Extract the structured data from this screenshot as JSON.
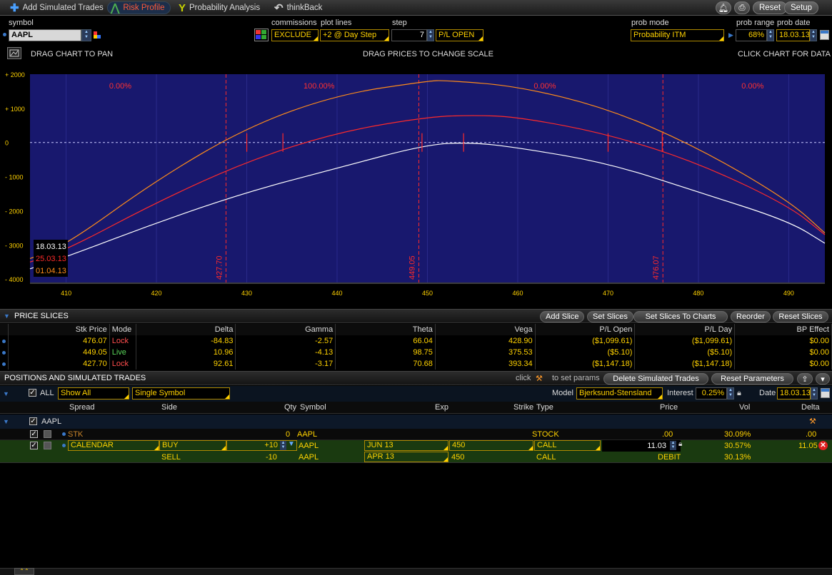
{
  "topbar": {
    "tabs": [
      {
        "label": "Add Simulated Trades",
        "icon": "plus-icon"
      },
      {
        "label": "Risk Profile",
        "icon": "risk-profile-icon",
        "active": true
      },
      {
        "label": "Probability Analysis",
        "icon": "probability-icon"
      },
      {
        "label": "thinkBack",
        "icon": "thinkback-icon"
      }
    ],
    "buttons": {
      "reset": "Reset",
      "setup": "Setup"
    }
  },
  "controls": {
    "symbol_label": "symbol",
    "symbol_value": "AAPL",
    "commissions_label": "commissions",
    "commissions_value": "EXCLUDE",
    "plotlines_label": "plot lines",
    "plotlines_value": "+2 @ Day Step",
    "step_label": "step",
    "step_value": "7",
    "pl_mode": "P/L OPEN",
    "probmode_label": "prob mode",
    "probmode_value": "Probability ITM",
    "probrange_label": "prob range",
    "probrange_value": "68%",
    "probdate_label": "prob date",
    "probdate_value": "18.03.13"
  },
  "chart_hints": {
    "left": "DRAG CHART TO PAN",
    "center": "DRAG PRICES TO CHANGE SCALE",
    "right": "CLICK CHART FOR DATA"
  },
  "chart_data": {
    "type": "line",
    "x_ticks": [
      "410",
      "420",
      "430",
      "440",
      "450",
      "460",
      "470",
      "480",
      "490"
    ],
    "y_ticks": [
      "+ 2000",
      "+ 1000",
      "0",
      "- 1000",
      "- 2000",
      "- 3000",
      "- 4000"
    ],
    "xlim": [
      406,
      494
    ],
    "ylim": [
      -4100,
      2000
    ],
    "series": [
      {
        "name": "18.03.13",
        "color": "#ffffff",
        "points": [
          [
            406,
            -3700
          ],
          [
            410,
            -3350
          ],
          [
            420,
            -2350
          ],
          [
            430,
            -1450
          ],
          [
            440,
            -750
          ],
          [
            450,
            -50
          ],
          [
            455,
            0
          ],
          [
            460,
            -150
          ],
          [
            470,
            -600
          ],
          [
            480,
            -1450
          ],
          [
            490,
            -2300
          ],
          [
            494,
            -2950
          ]
        ]
      },
      {
        "name": "25.03.13",
        "color": "#ff2a2a",
        "points": [
          [
            406,
            -3500
          ],
          [
            410,
            -3150
          ],
          [
            420,
            -1750
          ],
          [
            430,
            -550
          ],
          [
            440,
            300
          ],
          [
            450,
            750
          ],
          [
            455,
            800
          ],
          [
            460,
            750
          ],
          [
            470,
            250
          ],
          [
            480,
            -600
          ],
          [
            490,
            -1850
          ],
          [
            494,
            -2700
          ]
        ]
      },
      {
        "name": "01.04.13",
        "color": "#ff8c1a",
        "points": [
          [
            406,
            -3400
          ],
          [
            410,
            -3000
          ],
          [
            420,
            -1100
          ],
          [
            430,
            450
          ],
          [
            440,
            1400
          ],
          [
            450,
            1800
          ],
          [
            452,
            1820
          ],
          [
            460,
            1650
          ],
          [
            470,
            1000
          ],
          [
            480,
            -150
          ],
          [
            490,
            -1700
          ],
          [
            494,
            -2650
          ]
        ]
      }
    ],
    "slices": [
      {
        "price": 427.7,
        "label": "427.70"
      },
      {
        "price": 449.05,
        "label": "449.05"
      },
      {
        "price": 476.07,
        "label": "476.07"
      }
    ],
    "zone_labels": [
      {
        "text": "0.00%",
        "x": 416
      },
      {
        "text": "100.00%",
        "x": 438
      },
      {
        "text": "0.00%",
        "x": 463
      },
      {
        "text": "0.00%",
        "x": 486
      }
    ],
    "legend": [
      "18.03.13",
      "25.03.13",
      "01.04.13"
    ],
    "grid": true
  },
  "price_slices": {
    "title": "PRICE SLICES",
    "buttons": [
      "Add Slice",
      "Set Slices",
      "Set Slices To Charts",
      "Reorder",
      "Reset Slices"
    ],
    "columns": [
      "Stk Price",
      "Mode",
      "Delta",
      "Gamma",
      "Theta",
      "Vega",
      "P/L Open",
      "P/L Day",
      "BP Effect"
    ],
    "rows": [
      [
        "476.07",
        "Lock",
        "-84.83",
        "-2.57",
        "66.04",
        "428.90",
        "($1,099.61)",
        "($1,099.61)",
        "$0.00"
      ],
      [
        "449.05",
        "Live",
        "10.96",
        "-4.13",
        "98.75",
        "375.53",
        "($5.10)",
        "($5.10)",
        "$0.00"
      ],
      [
        "427.70",
        "Lock",
        "92.61",
        "-3.17",
        "70.68",
        "393.34",
        "($1,147.18)",
        "($1,147.18)",
        "$0.00"
      ]
    ]
  },
  "positions": {
    "title": "POSITIONS AND SIMULATED TRADES",
    "click_hint": "click",
    "params_hint": "to set params",
    "buttons": {
      "delete": "Delete Simulated Trades",
      "reset": "Reset Parameters"
    },
    "all_label": "ALL",
    "filter": "Show All",
    "symbol_filter": "Single Symbol",
    "model_label": "Model",
    "model_value": "Bjerksund-Stensland",
    "interest_label": "Interest",
    "interest_value": "0.25%",
    "date_label": "Date",
    "date_value": "18.03.13",
    "columns": [
      "Spread",
      "Side",
      "Qty",
      "Symbol",
      "Exp",
      "Strike",
      "Type",
      "Price",
      "Vol",
      "Delta"
    ],
    "group": "AAPL",
    "rows": {
      "stk": {
        "spread": "STK",
        "qty": "0",
        "symbol": "AAPL",
        "type": "STOCK",
        "price": ".00",
        "vol": "30.09%",
        "delta": ".00"
      },
      "cal_buy": {
        "spread": "CALENDAR",
        "side": "BUY",
        "qty": "+10",
        "symbol": "AAPL",
        "exp": "JUN 13",
        "strike": "450",
        "type": "CALL",
        "price": "11.03",
        "vol": "30.57%",
        "delta": "11.05"
      },
      "cal_sell": {
        "side": "SELL",
        "qty": "-10",
        "symbol": "AAPL",
        "exp": "APR 13",
        "strike": "450",
        "type": "CALL",
        "price": "DEBIT",
        "vol": "30.13%"
      }
    }
  }
}
